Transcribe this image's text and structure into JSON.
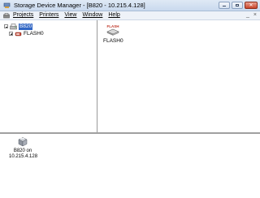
{
  "window": {
    "title": "Storage Device Manager - [B820 - 10.215.4.128]"
  },
  "menu": {
    "items": [
      "Projects",
      "Printers",
      "View",
      "Window",
      "Help"
    ],
    "mdi_controls": [
      "_",
      "×"
    ]
  },
  "tree": {
    "root_label": "B820",
    "child_label": "FLASH0"
  },
  "content": {
    "items": [
      {
        "label": "FLASH0",
        "caption": "FLASH"
      }
    ]
  },
  "bottom": {
    "device": {
      "line1": "B820 on",
      "line2": "10.215.4.128"
    }
  },
  "colors": {
    "selection": "#3166c4",
    "titlebar": "#c9d9ee"
  },
  "icons": {
    "app": "app-icon",
    "menu": "projects-icon",
    "tree_root": "printer-icon",
    "tree_child": "flash-drive-icon",
    "device": "printer-icon"
  }
}
